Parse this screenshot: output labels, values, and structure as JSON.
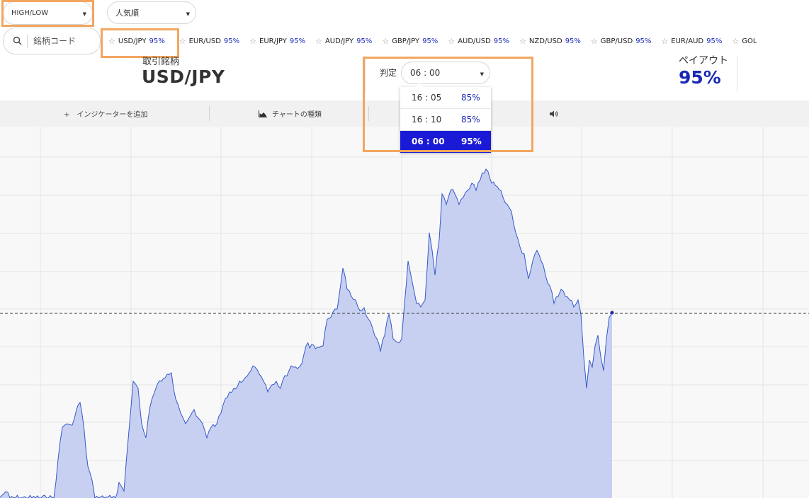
{
  "header": {
    "trade_type": "HIGH/LOW",
    "sort_order": "人気順",
    "search_placeholder": "銘柄コード"
  },
  "pairs": [
    {
      "name": "USD/JPY",
      "payout": "95%"
    },
    {
      "name": "EUR/USD",
      "payout": "95%"
    },
    {
      "name": "EUR/JPY",
      "payout": "95%"
    },
    {
      "name": "AUD/JPY",
      "payout": "95%"
    },
    {
      "name": "GBP/JPY",
      "payout": "95%"
    },
    {
      "name": "AUD/USD",
      "payout": "95%"
    },
    {
      "name": "NZD/USD",
      "payout": "95%"
    },
    {
      "name": "GBP/USD",
      "payout": "95%"
    },
    {
      "name": "EUR/AUD",
      "payout": "95%"
    },
    {
      "name": "GOL",
      "payout": ""
    }
  ],
  "instrument": {
    "label": "取引銘柄",
    "name": "USD/JPY"
  },
  "judgement": {
    "label": "判定",
    "selected_time": "06 : 00",
    "options": [
      {
        "time": "16 : 05",
        "payout": "85%"
      },
      {
        "time": "16 : 10",
        "payout": "85%"
      },
      {
        "time": "06 : 00",
        "payout": "95%"
      }
    ]
  },
  "payout": {
    "label": "ペイアウト",
    "value": "95%"
  },
  "toolbar": {
    "add_indicator": "+　インジケーターを追加",
    "chart_type": "チャートの種類"
  },
  "colors": {
    "accent": "#1a2ab5",
    "selected_option": "#1a1ad6",
    "highlight_box": "#f2a65e",
    "chart_fill": "#c7d0f1",
    "chart_line": "#3558c9"
  }
}
